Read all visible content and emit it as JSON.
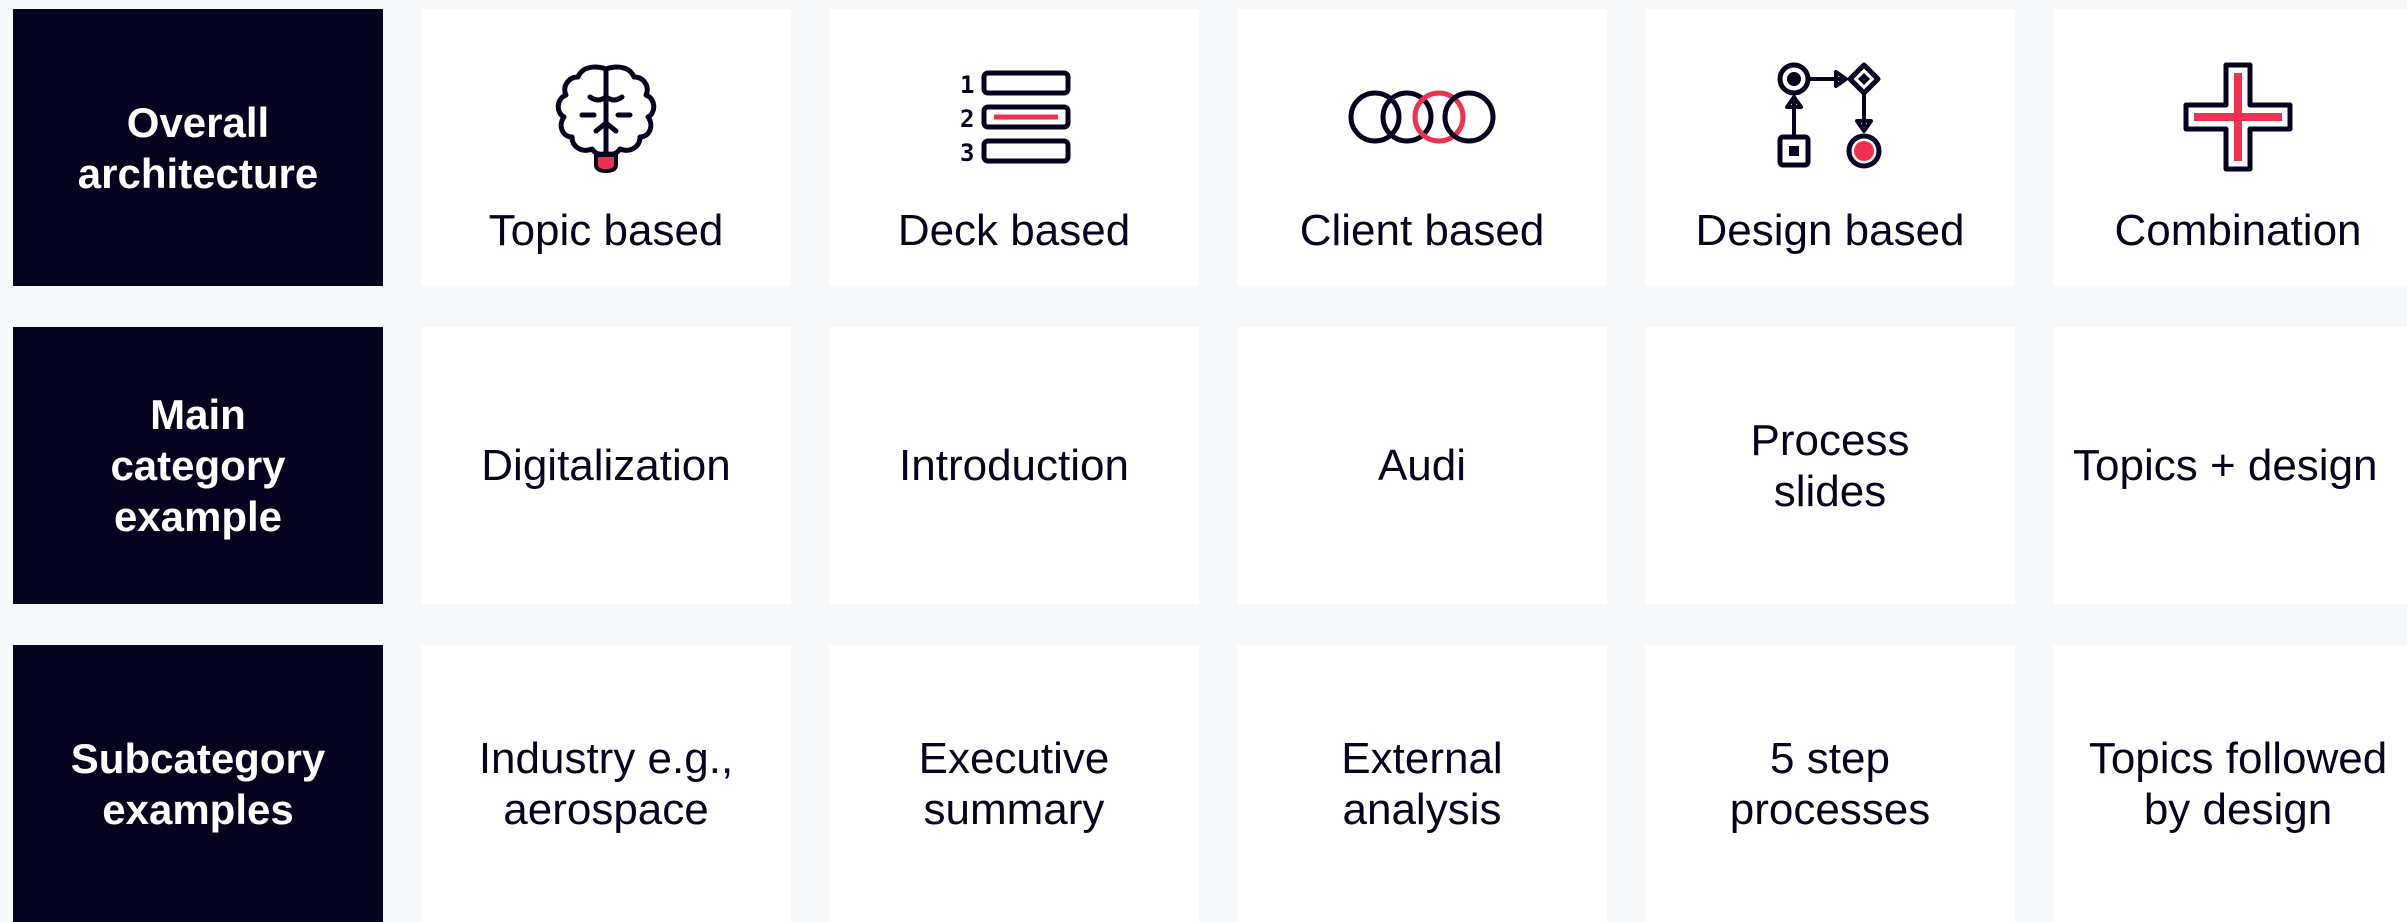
{
  "rows": [
    {
      "header": "Overall\narchitecture",
      "cells": [
        {
          "label": "Topic based",
          "icon": "brain-icon"
        },
        {
          "label": "Deck based",
          "icon": "numbered-list-icon"
        },
        {
          "label": "Client based",
          "icon": "four-rings-icon"
        },
        {
          "label": "Design based",
          "icon": "flowchart-icon"
        },
        {
          "label": "Combination",
          "icon": "plus-cross-icon"
        }
      ]
    },
    {
      "header": "Main\ncategory\nexample",
      "cells": [
        {
          "label": "Digitalization"
        },
        {
          "label": "Introduction"
        },
        {
          "label": "Audi"
        },
        {
          "label": "Process\nslides"
        },
        {
          "label": "Topics + design"
        }
      ]
    },
    {
      "header": "Subcategory\nexamples",
      "cells": [
        {
          "label": "Industry e.g.,\naerospace"
        },
        {
          "label": "Executive\nsummary"
        },
        {
          "label": "External\nanalysis"
        },
        {
          "label": "5 step\nprocesses"
        },
        {
          "label": "Topics followed\nby design"
        }
      ]
    }
  ],
  "colors": {
    "header_bg": "#06031f",
    "cell_bg": "#ffffff",
    "page_bg": "#f7f8fa",
    "text": "#06031f",
    "accent": "#f0304f"
  }
}
